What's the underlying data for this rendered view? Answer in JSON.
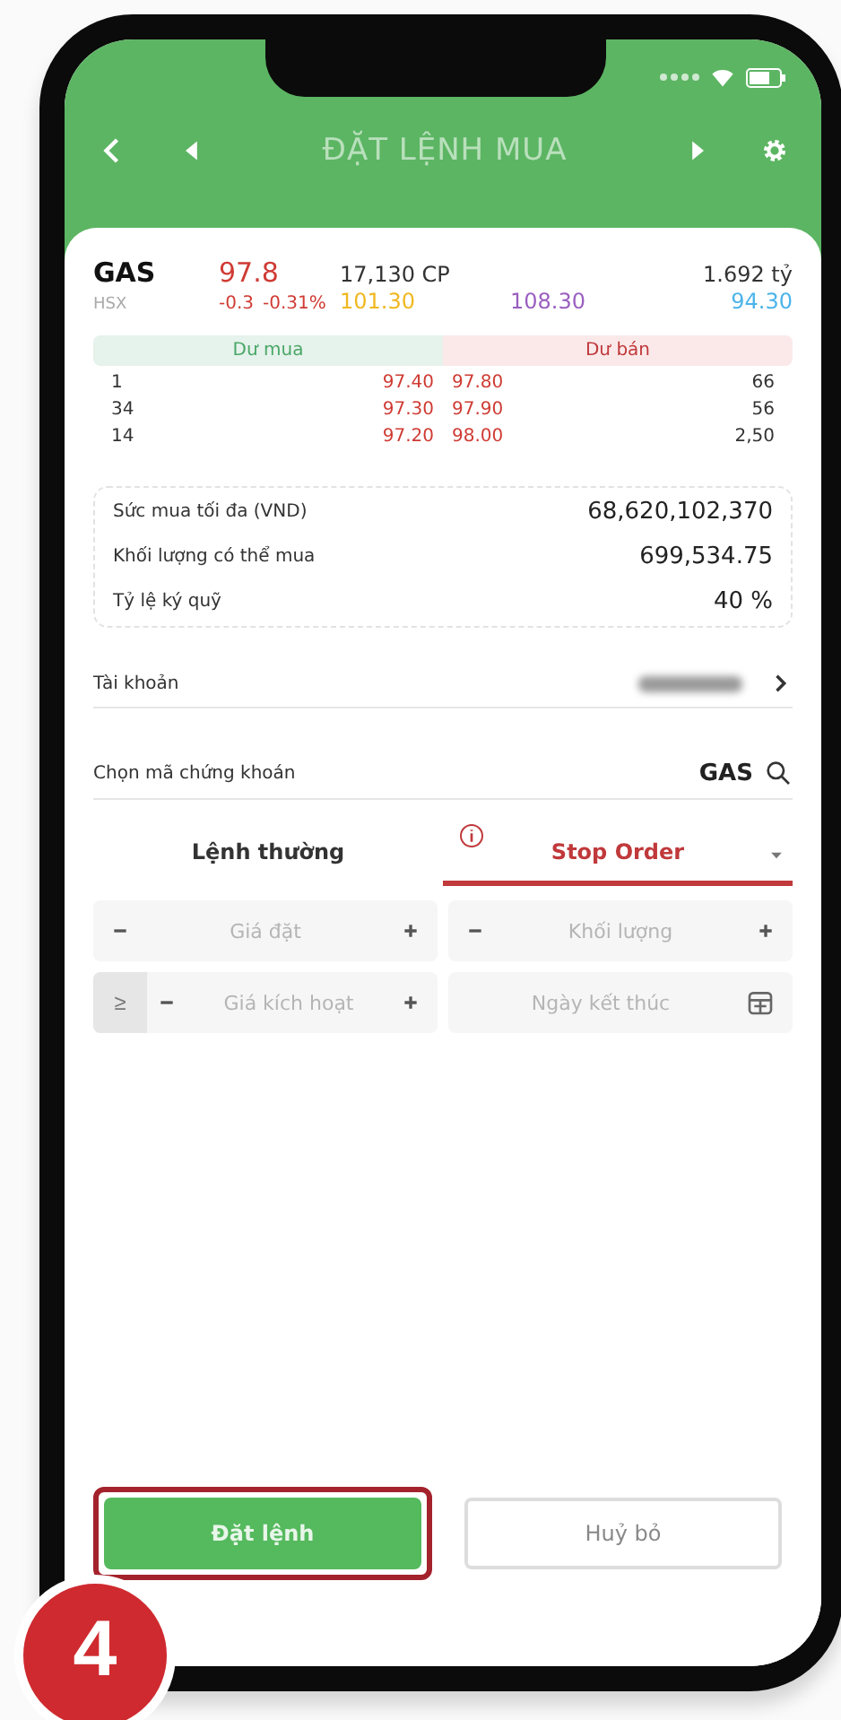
{
  "header": {
    "title": "ĐẶT LỆNH MUA"
  },
  "quote": {
    "symbol": "GAS",
    "exchange": "HSX",
    "price": "97.8",
    "change": "-0.3",
    "change_pct": "-0.31%",
    "volume": "17,130 CP",
    "value": "1.692 tỷ",
    "ref": "101.30",
    "ceiling": "108.30",
    "floor": "94.30"
  },
  "order_book": {
    "bid_label": "Dư mua",
    "ask_label": "Dư bán",
    "rows": [
      {
        "bid_qty": "1",
        "bid_price": "97.40",
        "ask_price": "97.80",
        "ask_qty": "66"
      },
      {
        "bid_qty": "34",
        "bid_price": "97.30",
        "ask_price": "97.90",
        "ask_qty": "56"
      },
      {
        "bid_qty": "14",
        "bid_price": "97.20",
        "ask_price": "98.00",
        "ask_qty": "2,50"
      }
    ]
  },
  "summary": [
    {
      "label": "Sức mua tối đa (VND)",
      "value": "68,620,102,370"
    },
    {
      "label": "Khối lượng có thể mua",
      "value": "699,534.75"
    },
    {
      "label": "Tỷ lệ ký quỹ",
      "value": "40 %"
    }
  ],
  "account": {
    "label": "Tài khoản"
  },
  "symbol_picker": {
    "label": "Chọn mã chứng khoán",
    "value": "GAS"
  },
  "order_tabs": [
    {
      "label": "Lệnh thường",
      "selected": false
    },
    {
      "label": "Stop Order",
      "selected": true
    }
  ],
  "fields": [
    {
      "kind": "stepper",
      "placeholder": "Giá đặt"
    },
    {
      "kind": "stepper",
      "placeholder": "Khối lượng"
    },
    {
      "kind": "trigger",
      "operator": "≥",
      "placeholder": "Giá kích hoạt"
    },
    {
      "kind": "date",
      "placeholder": "Ngày kết thúc"
    }
  ],
  "buttons": [
    {
      "label": "Đặt lệnh",
      "kind": "primary",
      "highlighted": true
    },
    {
      "label": "Huỷ bỏ",
      "kind": "secondary",
      "highlighted": false
    }
  ],
  "step_badge": "4"
}
